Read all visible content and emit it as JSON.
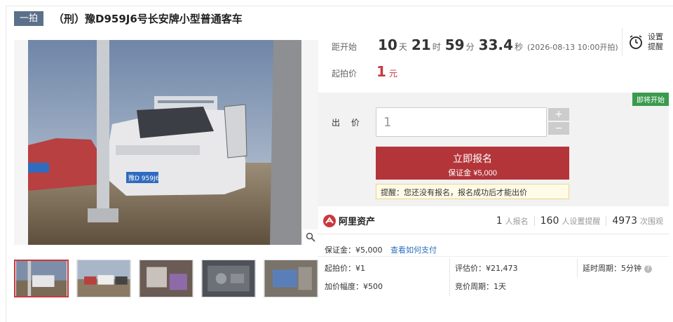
{
  "header": {
    "tag": "一拍",
    "title": "（刑）豫D959J6号长安牌小型普通客车"
  },
  "countdown": {
    "label": "距开始",
    "days": "10",
    "days_unit": "天",
    "hours": "21",
    "hours_unit": "时",
    "minutes": "59",
    "minutes_unit": "分",
    "seconds": "33.4",
    "seconds_unit": "秒",
    "start_note": "(2026-08-13 10:00开拍)"
  },
  "start_price": {
    "label": "起拍价",
    "value": "1",
    "unit": "元"
  },
  "reminder": {
    "label_line1": "设置",
    "label_line2": "提醒",
    "icon": "alarm-clock-icon"
  },
  "bid": {
    "status_badge": "即将开始",
    "label": "出 价",
    "input_value": "1",
    "plus": "+",
    "minus": "−",
    "signup_label": "立即报名",
    "deposit_label": "保证金 ¥5,000",
    "tip": "提醒：您还没有报名，报名成功后才能出价"
  },
  "brand": {
    "name": "阿里资产",
    "icon": "ali-asset-logo-icon"
  },
  "stats": [
    {
      "num": "1",
      "label": "人报名"
    },
    {
      "num": "160",
      "label": "人设置提醒"
    },
    {
      "num": "4973",
      "label": "次围观"
    }
  ],
  "info": {
    "deposit": "保证金：¥5,000",
    "pay_link": "查看如何支付",
    "start_price": "起拍价：¥1",
    "appraisal": "评估价：¥21,473",
    "delay": "延时周期：5分钟",
    "increment": "加价幅度：¥500",
    "cycle": "竞价周期：1天"
  },
  "colors": {
    "accent_red": "#b3353a",
    "tag_bg": "#5b708a",
    "badge_green": "#3a9a4e",
    "link_blue": "#2d6fbf"
  },
  "gallery": {
    "plate_text": "豫D 959J6"
  }
}
